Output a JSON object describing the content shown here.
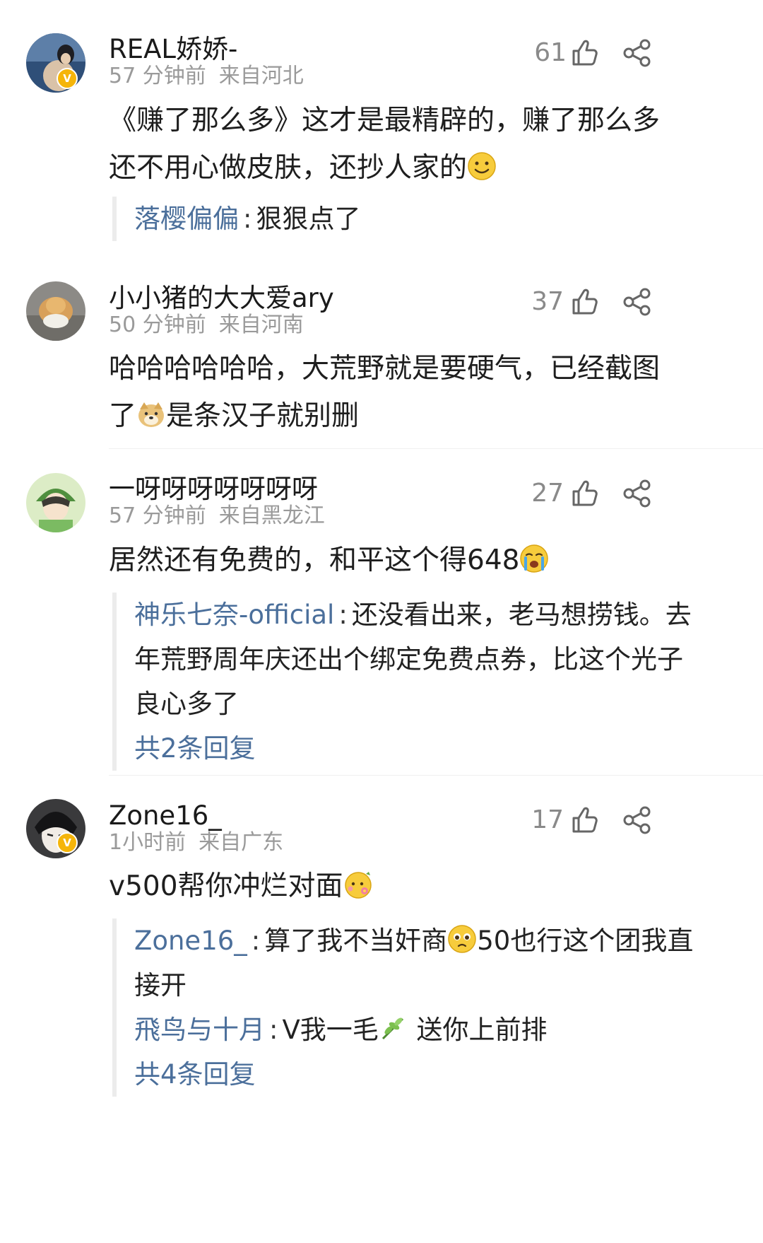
{
  "comments": [
    {
      "username": "REAL娇娇-",
      "time": "57 分钟前",
      "location": "来自河北",
      "likes": "61",
      "verified": true,
      "content_line1": "《赚了那么多》这才是最精辟的，赚了那么多",
      "content_line2": "还不用心做皮肤，还抄人家的",
      "content_emoji": "smile-emoji",
      "replies": [
        {
          "author": "落樱偏偏",
          "sep": ":",
          "text": "狠狠点了"
        }
      ]
    },
    {
      "username": "小小猪的大大爱ary",
      "time": "50 分钟前",
      "location": "来自河南",
      "likes": "37",
      "verified": false,
      "content_line1": "哈哈哈哈哈哈，大荒野就是要硬气，已经截图",
      "content_line2_a": "了",
      "content_line2_b": "是条汉子就别删",
      "content_emoji": "doge-emoji"
    },
    {
      "username": "一呀呀呀呀呀呀呀",
      "time": "57 分钟前",
      "location": "来自黑龙江",
      "likes": "27",
      "verified": false,
      "content_line1": "居然还有免费的，和平这个得648",
      "content_emoji": "crying-emoji",
      "replies": [
        {
          "author": "神乐七奈-official",
          "sep": ":",
          "text_line1": "还没看出来，老马想捞钱。去",
          "text_line2": "年荒野周年庆还出个绑定免费点券，比这个光子",
          "text_line3": "良心多了"
        }
      ],
      "reply_total": "共2条回复"
    },
    {
      "username": "Zone16_",
      "time": "1小时前",
      "location": "来自广东",
      "likes": "17",
      "verified": true,
      "content_line1": "v500帮你冲烂对面",
      "content_emoji": "flower-face-emoji",
      "replies": [
        {
          "author": "Zone16_",
          "sep": ":",
          "text_a": "算了我不当奸商",
          "text_b": "50也行这个团我直",
          "text_line2": "接开",
          "emoji": "pleading-emoji"
        },
        {
          "author": "飛鸟与十月",
          "sep": ":",
          "text_a": "V我一毛",
          "text_b": " 送你上前排",
          "emoji": "leaf-emoji"
        }
      ],
      "reply_total": "共4条回复"
    }
  ],
  "icons": {
    "like": "thumbs-up-icon",
    "share": "share-icon",
    "verified": "verified-badge-icon"
  },
  "colors": {
    "link": "#4b6f9b",
    "meta": "#9a9a9a",
    "badge": "#f5b50a"
  }
}
